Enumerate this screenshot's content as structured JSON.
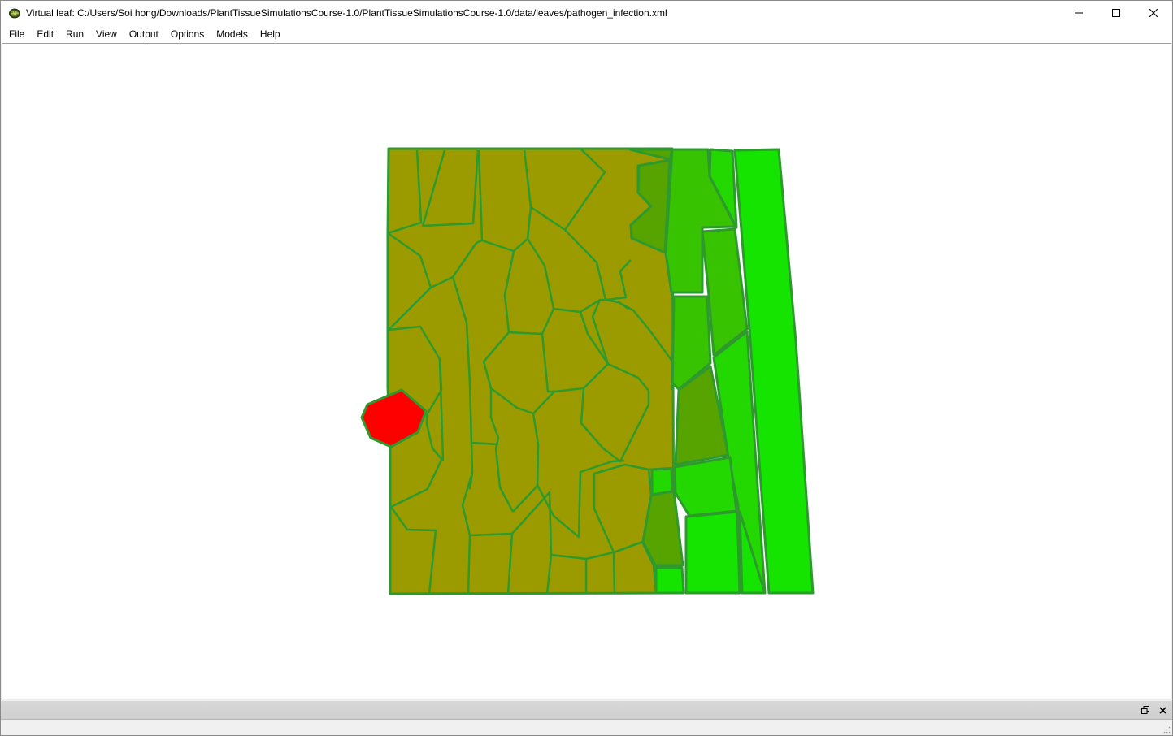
{
  "window": {
    "title": "Virtual leaf: C:/Users/Soi hong/Downloads/PlantTissueSimulationsCourse-1.0/PlantTissueSimulationsCourse-1.0/data/leaves/pathogen_infection.xml",
    "icon": "leaf-app-icon",
    "controls": [
      "minimize-icon",
      "maximize-icon",
      "close-icon"
    ]
  },
  "menu": {
    "items": [
      "File",
      "Edit",
      "Run",
      "View",
      "Output",
      "Options",
      "Models",
      "Help"
    ]
  },
  "tissue": {
    "colors": {
      "olive_cell": "#9b9b00",
      "dark_green_cell": "#57a300",
      "mid_green_cell": "#37c300",
      "light_green_cell": "#22d800",
      "bright_green_cell": "#14e400",
      "infected_cell": "#ff0000",
      "cell_wall": "#2e9a2e"
    },
    "infected_cell_count": 1
  },
  "dock": {
    "buttons": [
      "float-icon",
      "close-icon"
    ]
  }
}
